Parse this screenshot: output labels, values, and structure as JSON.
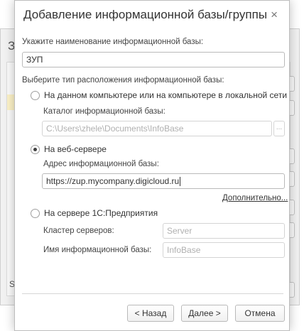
{
  "background_window": {
    "title_fragment": "З",
    "footer_fragment": "S",
    "button_fragment": "е"
  },
  "dialog": {
    "title": "Добавление информационной базы/группы",
    "close_label": "×",
    "name_label": "Укажите наименование информационной базы:",
    "name_value": "ЗУП",
    "location_label": "Выберите тип расположения информационной базы:",
    "options": {
      "local": {
        "label": "На данном компьютере или на компьютере в локальной сети",
        "selected": false,
        "catalog_label": "Каталог информационной базы:",
        "catalog_value": "C:\\Users\\zhele\\Documents\\InfoBase",
        "browse_label": "..."
      },
      "web": {
        "label": "На веб-сервере",
        "selected": true,
        "address_label": "Адрес информационной базы:",
        "address_value": "https://zup.mycompany.digicloud.ru",
        "more_link": "Дополнительно..."
      },
      "server": {
        "label": "На сервере 1С:Предприятия",
        "selected": false,
        "cluster_label": "Кластер серверов:",
        "cluster_placeholder": "Server",
        "ib_name_label": "Имя информационной базы:",
        "ib_name_placeholder": "InfoBase"
      }
    },
    "buttons": {
      "back": "< Назад",
      "next": "Далее >",
      "cancel": "Отмена"
    }
  }
}
